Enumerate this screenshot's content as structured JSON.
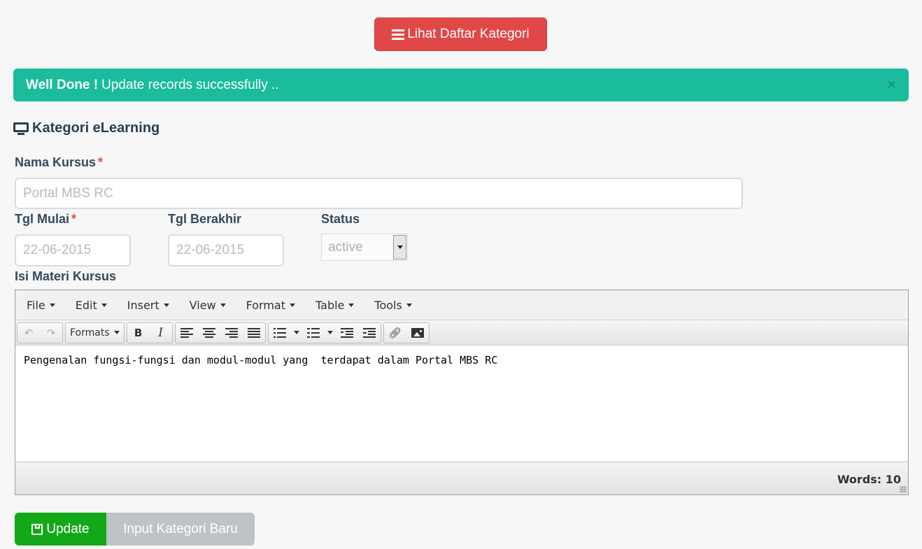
{
  "header": {
    "list_button_label": "Lihat Daftar Kategori"
  },
  "alert": {
    "strong": "Well Done !",
    "message": "Update records successfully ..",
    "close": "×"
  },
  "section": {
    "title": "Kategori eLearning"
  },
  "form": {
    "nama_kursus": {
      "label": "Nama Kursus",
      "required": "*",
      "value": "Portal MBS RC"
    },
    "tgl_mulai": {
      "label": "Tgl Mulai",
      "required": "*",
      "value": "22-06-2015"
    },
    "tgl_berakhir": {
      "label": "Tgl Berakhir",
      "value": "22-06-2015"
    },
    "status": {
      "label": "Status",
      "value": "active"
    },
    "isi_materi": {
      "label": "Isi Materi Kursus"
    }
  },
  "editor": {
    "menu": [
      "File",
      "Edit",
      "Insert",
      "View",
      "Format",
      "Table",
      "Tools"
    ],
    "formats_label": "Formats",
    "bold": "B",
    "italic": "I",
    "content": "Pengenalan fungsi-fungsi dan modul-modul yang  terdapat dalam Portal MBS RC",
    "word_count": "Words: 10"
  },
  "actions": {
    "update_label": "Update",
    "new_label": "Input Kategori Baru"
  },
  "colors": {
    "danger": "#e04848",
    "success_alert": "#1abc9c",
    "update": "#13a818",
    "disabled": "#bdc3c7"
  }
}
